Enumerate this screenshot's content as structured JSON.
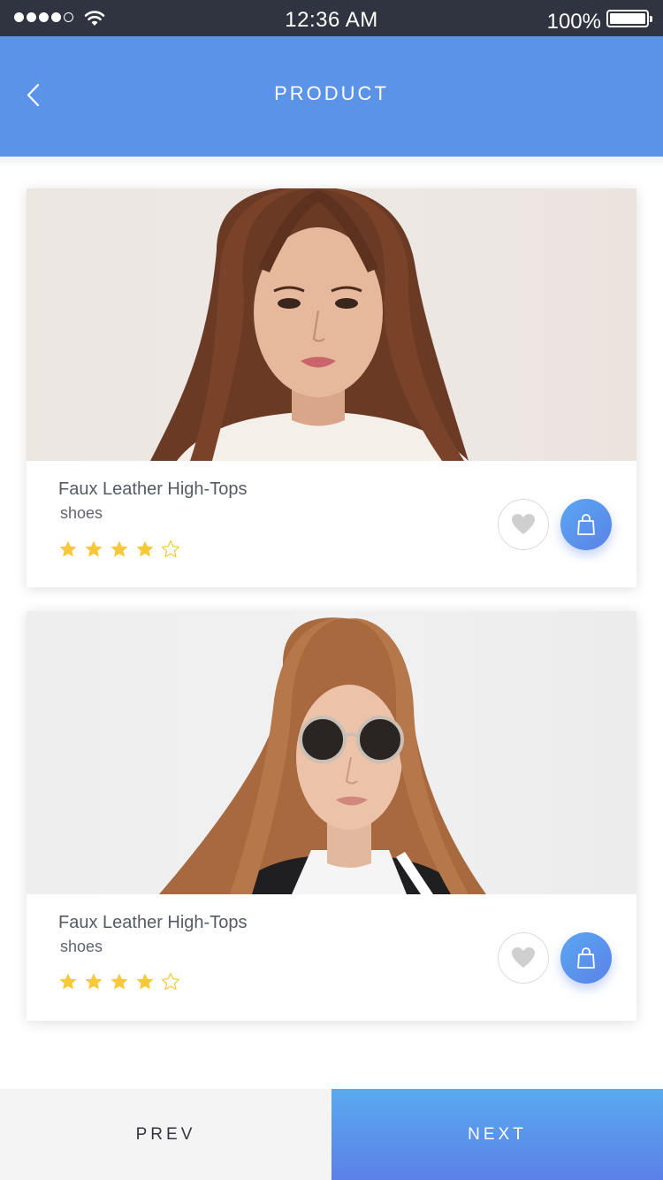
{
  "status_bar": {
    "time": "12:36 AM",
    "battery_percent": "100%",
    "signal_bars_filled": 4,
    "signal_bars_total": 5,
    "wifi_icon": "wifi-icon",
    "battery_icon": "battery-icon"
  },
  "header": {
    "title": "PRODUCT",
    "back_icon": "chevron-left-icon",
    "background_color": "#5b93e9"
  },
  "products": [
    {
      "name": "Faux Leather High-Tops",
      "category": "shoes",
      "rating": 4,
      "rating_max": 5,
      "photo_icon": "product-photo-woman-brown-hair",
      "favorite_icon": "heart-icon",
      "cart_icon": "shopping-bag-icon"
    },
    {
      "name": "Faux Leather High-Tops",
      "category": "shoes",
      "rating": 4,
      "rating_max": 5,
      "photo_icon": "product-photo-woman-sunglasses",
      "favorite_icon": "heart-icon",
      "cart_icon": "shopping-bag-icon"
    }
  ],
  "footer": {
    "prev_label": "PREV",
    "next_label": "NEXT"
  },
  "colors": {
    "accent": "#5b93e9",
    "star_filled": "#f7c935",
    "status_bar": "#2f3440"
  }
}
